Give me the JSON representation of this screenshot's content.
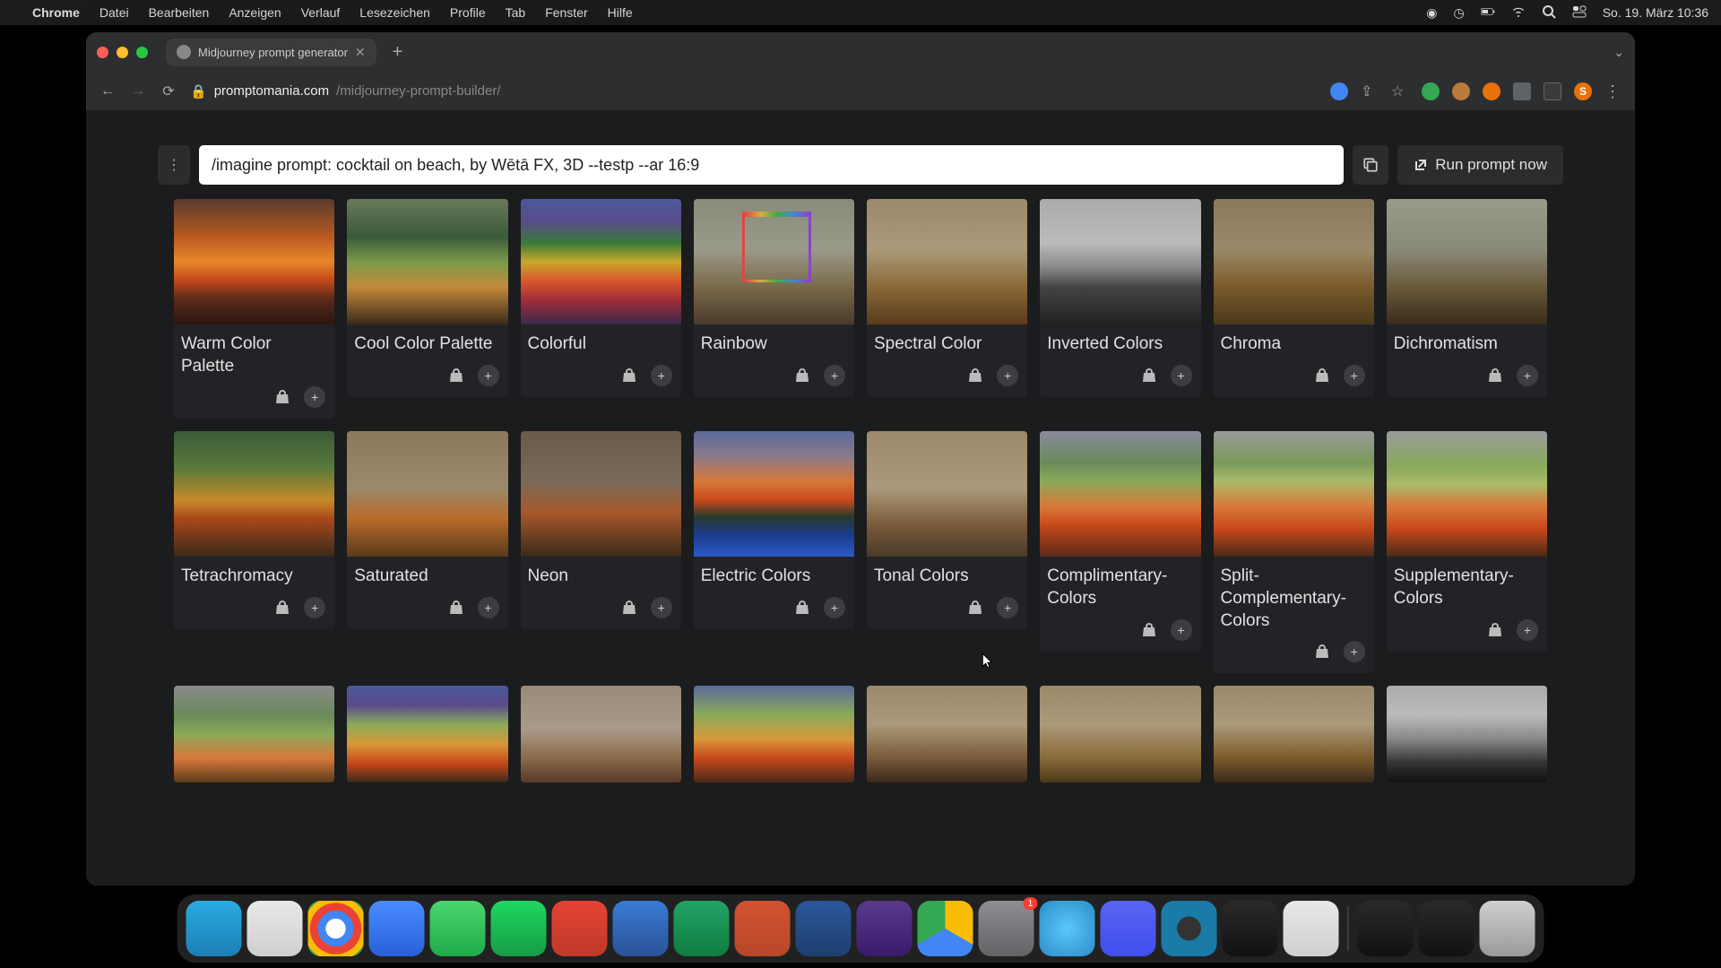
{
  "menubar": {
    "app": "Chrome",
    "items": [
      "Datei",
      "Bearbeiten",
      "Anzeigen",
      "Verlauf",
      "Lesezeichen",
      "Profile",
      "Tab",
      "Fenster",
      "Hilfe"
    ],
    "clock": "So. 19. März  10:36"
  },
  "browser": {
    "tab_title": "Midjourney prompt generator",
    "url_host": "promptomania.com",
    "url_path": "/midjourney-prompt-builder/",
    "avatar_initial": "S"
  },
  "prompt": {
    "text": "/imagine prompt: cocktail on beach, by Wētā FX, 3D --testp --ar 16:9",
    "run_label": "Run prompt now"
  },
  "styles": [
    {
      "label": "Warm Color Palette",
      "thumb": "t-warm"
    },
    {
      "label": "Cool Color Palette",
      "thumb": "t-cool"
    },
    {
      "label": "Colorful",
      "thumb": "t-colorful"
    },
    {
      "label": "Rainbow",
      "thumb": "t-rainbow"
    },
    {
      "label": "Spectral Color",
      "thumb": "t-spectral"
    },
    {
      "label": "Inverted Colors",
      "thumb": "t-inverted"
    },
    {
      "label": "Chroma",
      "thumb": "t-chroma"
    },
    {
      "label": "Dichromatism",
      "thumb": "t-dichrom"
    },
    {
      "label": "Tetrachromacy",
      "thumb": "t-tetra"
    },
    {
      "label": "Saturated",
      "thumb": "t-sat"
    },
    {
      "label": "Neon",
      "thumb": "t-neon"
    },
    {
      "label": "Electric Colors",
      "thumb": "t-electric"
    },
    {
      "label": "Tonal Colors",
      "thumb": "t-tonal"
    },
    {
      "label": "Complimentary-Colors",
      "thumb": "t-comp"
    },
    {
      "label": "Split-Complementary-Colors",
      "thumb": "t-split"
    },
    {
      "label": "Supplementary-Colors",
      "thumb": "t-supp"
    }
  ],
  "row3_thumbs": [
    "t-r3a",
    "t-r3b",
    "t-r3c",
    "t-r3d",
    "t-r3e",
    "t-r3f",
    "t-r3g",
    "t-r3h"
  ],
  "dock": {
    "badge_settings": "1",
    "apps": [
      {
        "name": "finder",
        "bg": "linear-gradient(180deg,#29abe2,#1b7fb5)"
      },
      {
        "name": "safari",
        "bg": "linear-gradient(180deg,#e8e8e8,#cfcfcf)"
      },
      {
        "name": "chrome",
        "bg": "radial-gradient(circle,#fff 25%,#4285f4 26% 45%,#ea4335 46% 65%,#fbbc05 66% 82%,#34a853 83%)"
      },
      {
        "name": "zoom",
        "bg": "linear-gradient(180deg,#4a8cff,#2760d8)"
      },
      {
        "name": "whatsapp",
        "bg": "linear-gradient(180deg,#4ad66d,#1faa4a)"
      },
      {
        "name": "spotify",
        "bg": "linear-gradient(180deg,#1ed760,#169c46)"
      },
      {
        "name": "todoist",
        "bg": "linear-gradient(180deg,#e44332,#c0392b)"
      },
      {
        "name": "trello",
        "bg": "linear-gradient(180deg,#3a7bd5,#2a5298)"
      },
      {
        "name": "excel",
        "bg": "linear-gradient(180deg,#21a366,#107c41)"
      },
      {
        "name": "powerpoint",
        "bg": "linear-gradient(180deg,#d35230,#b7472a)"
      },
      {
        "name": "word",
        "bg": "linear-gradient(180deg,#2b579a,#1e3f6f)"
      },
      {
        "name": "imovie",
        "bg": "linear-gradient(180deg,#5a3a8a,#3a1a6a)"
      },
      {
        "name": "drive",
        "bg": "conic-gradient(#fbbc05 0 120deg,#4285f4 120deg 240deg,#34a853 240deg)"
      },
      {
        "name": "settings",
        "bg": "linear-gradient(180deg,#8e8e93,#636366)",
        "badge": true
      },
      {
        "name": "app-circle",
        "bg": "radial-gradient(circle,#5ac8fa,#2a8cc8)"
      },
      {
        "name": "discord",
        "bg": "linear-gradient(180deg,#5865f2,#404eed)"
      },
      {
        "name": "quicktime",
        "bg": "radial-gradient(circle,#333 30%,#1a7aa8 31%)"
      },
      {
        "name": "voice",
        "bg": "linear-gradient(180deg,#2a2a2a,#111)"
      },
      {
        "name": "preview",
        "bg": "linear-gradient(180deg,#e8e8e8,#cfcfcf)"
      }
    ]
  }
}
